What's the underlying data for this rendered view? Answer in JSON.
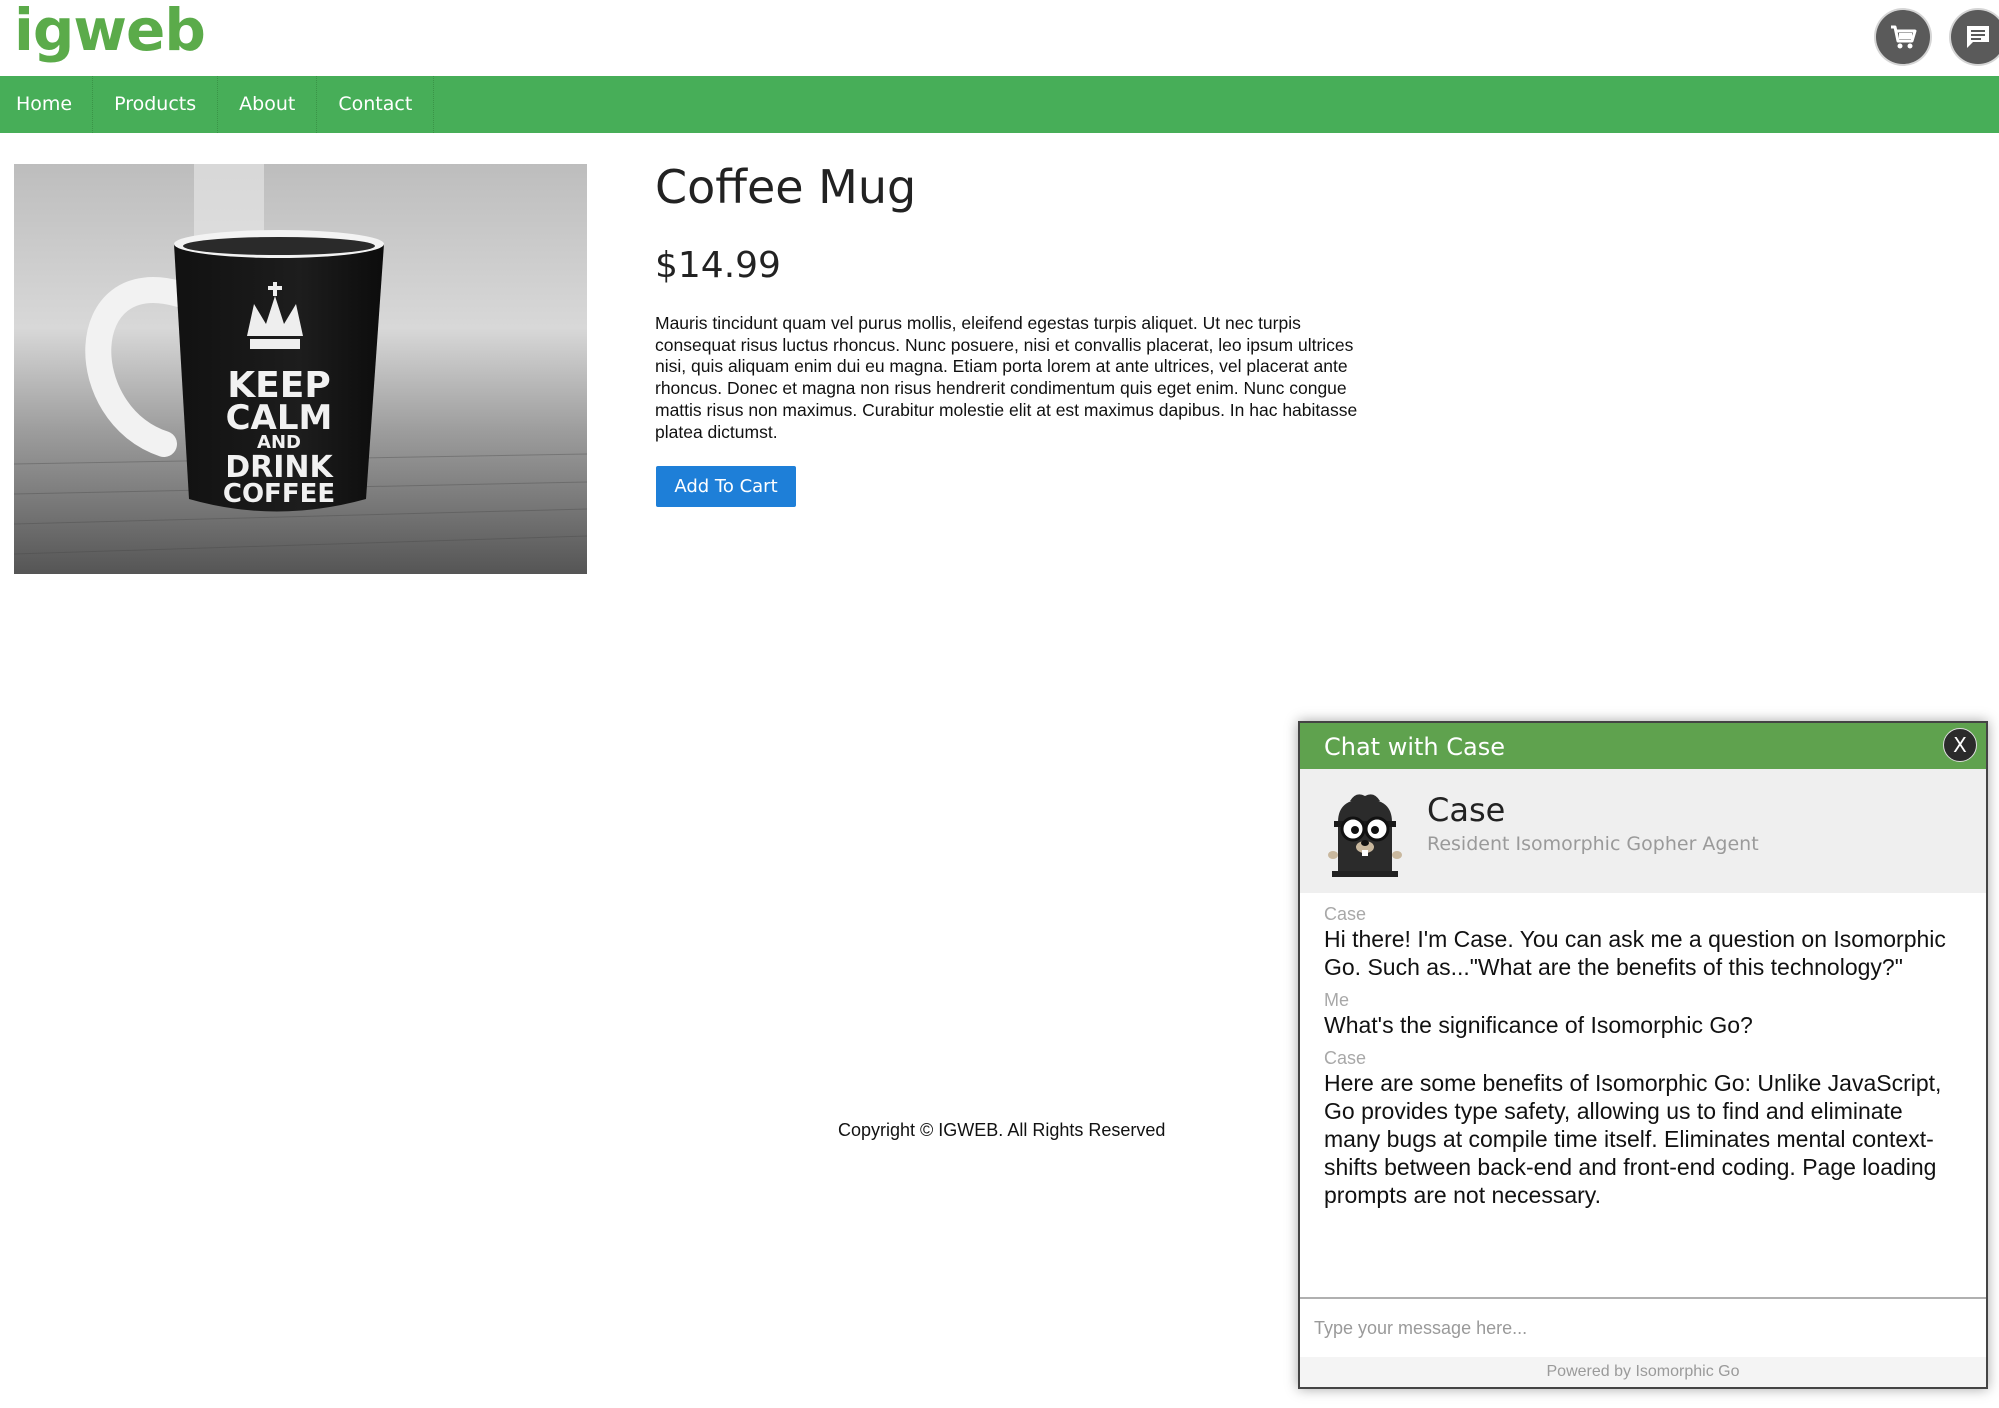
{
  "header": {
    "logo": "igweb",
    "cart_icon": "cart-icon",
    "chat_icon": "chat-bubble-icon"
  },
  "nav": {
    "items": [
      "Home",
      "Products",
      "About",
      "Contact"
    ]
  },
  "product": {
    "image_text": "KEEP CALM AND DRINK COFFEE",
    "image_lines": [
      "KEEP",
      "CALM",
      "AND",
      "DRINK",
      "COFFEE"
    ],
    "title": "Coffee Mug",
    "price": "$14.99",
    "description": "Mauris tincidunt quam vel purus mollis, eleifend egestas turpis aliquet. Ut nec turpis consequat risus luctus rhoncus. Nunc posuere, nisi et convallis placerat, leo ipsum ultrices nisi, quis aliquam enim dui eu magna. Etiam porta lorem at ante ultrices, vel placerat ante rhoncus. Donec et magna non risus hendrerit condimentum quis eget enim. Nunc congue mattis risus non maximus. Curabitur molestie elit at est maximus dapibus. In hac habitasse platea dictumst.",
    "add_to_cart_label": "Add To Cart"
  },
  "footer": {
    "copyright": "Copyright © IGWEB. All Rights Reserved"
  },
  "chat": {
    "title": "Chat with Case",
    "close_label": "X",
    "agent": {
      "name": "Case",
      "role": "Resident Isomorphic Gopher Agent"
    },
    "messages": [
      {
        "sender": "Case",
        "text": "Hi there! I'm Case. You can ask me a question on Isomorphic Go. Such as...\"What are the benefits of this technology?\""
      },
      {
        "sender": "Me",
        "text": "What's the significance of Isomorphic Go?"
      },
      {
        "sender": "Case",
        "text": "Here are some benefits of Isomorphic Go: Unlike JavaScript, Go provides type safety, allowing us to find and eliminate many bugs at compile time itself. Eliminates mental context-shifts between back-end and front-end coding. Page loading prompts are not necessary."
      }
    ],
    "input_placeholder": "Type your message here...",
    "footer": "Powered by Isomorphic Go"
  },
  "colors": {
    "brand_green": "#5bab4a",
    "nav_green": "#47ae58",
    "chat_green": "#5fa24e",
    "button_blue": "#1e7fd8"
  }
}
